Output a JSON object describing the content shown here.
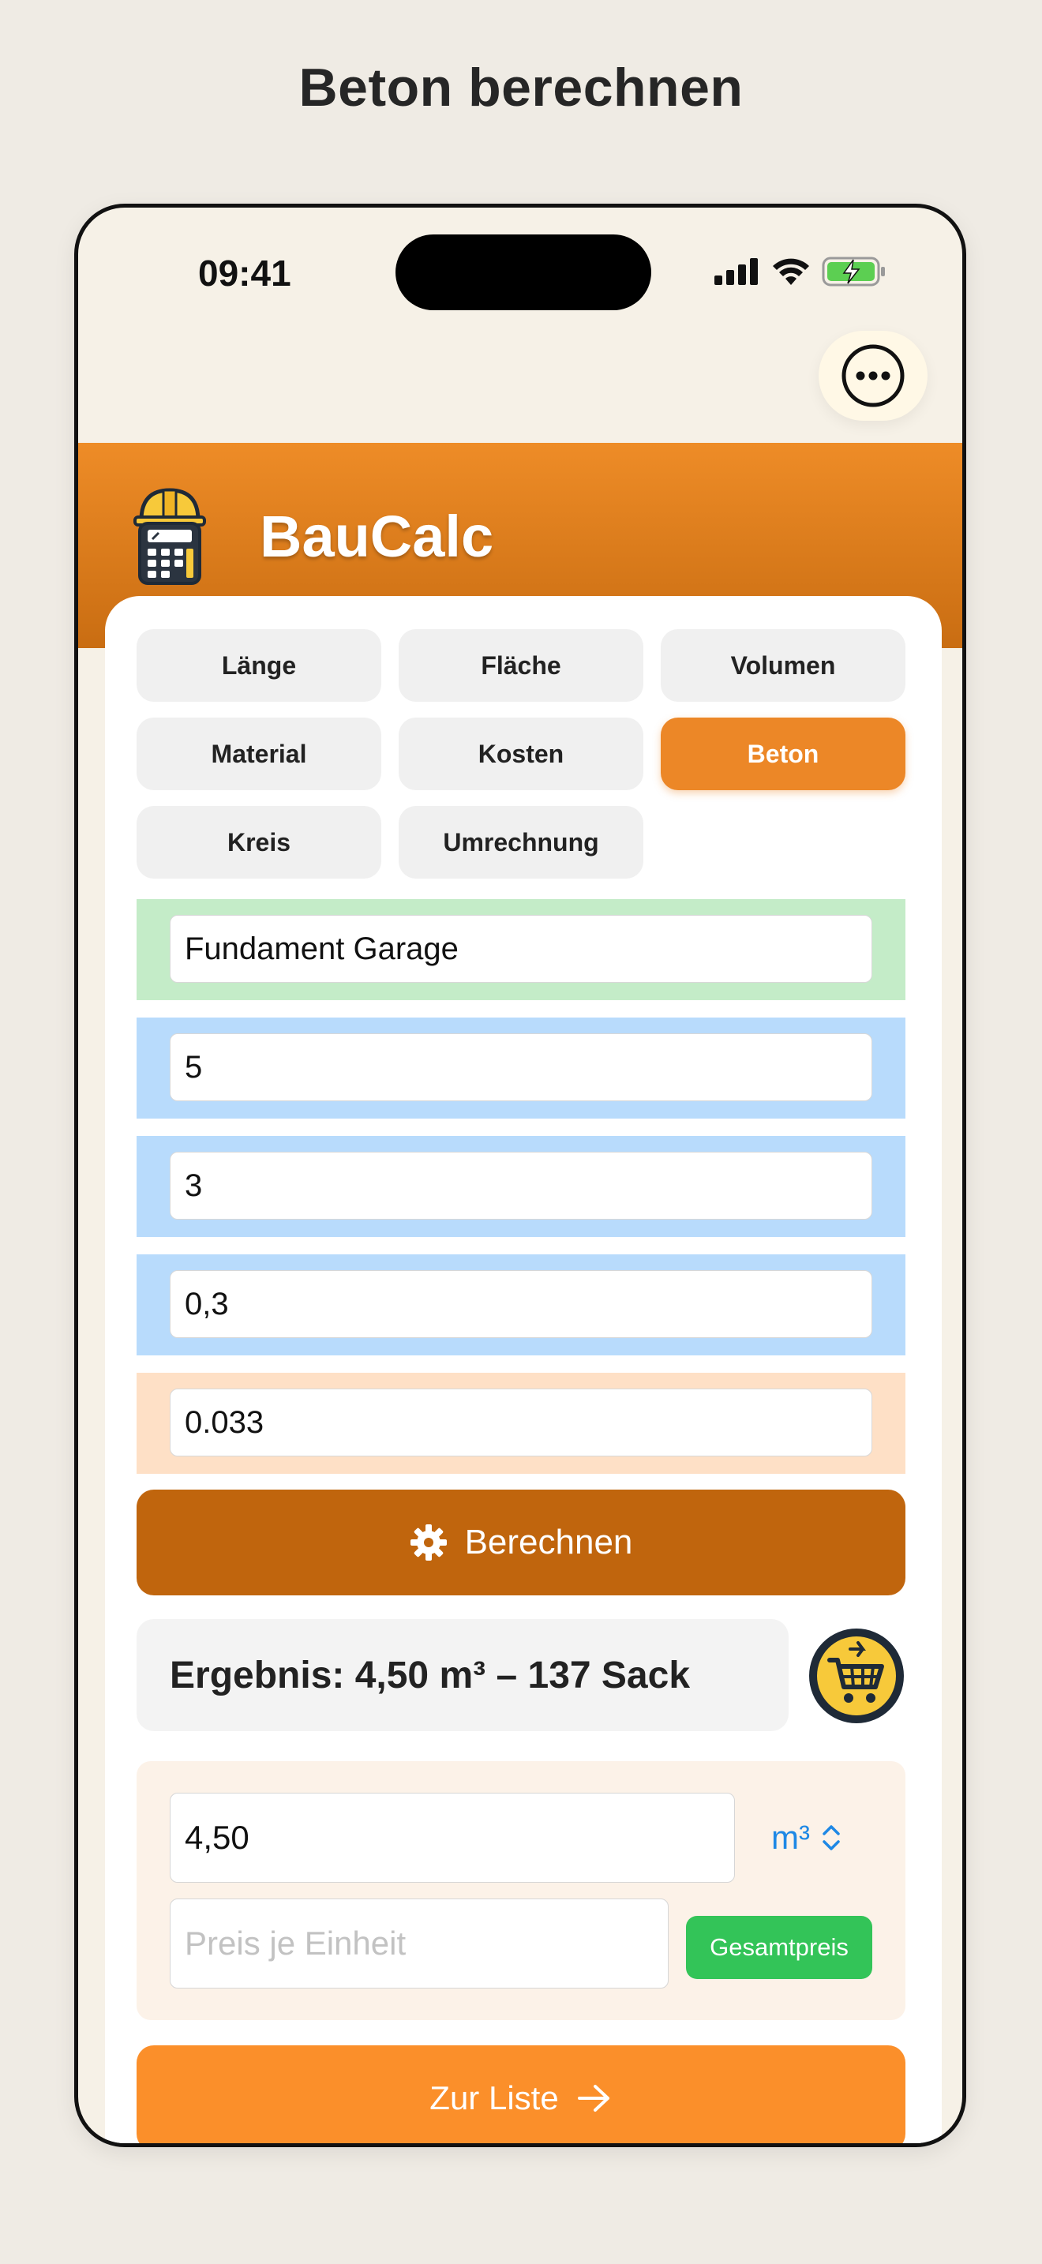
{
  "page": {
    "title": "Beton berechnen"
  },
  "status_bar": {
    "time": "09:41"
  },
  "app": {
    "name": "BauCalc",
    "logo_icon": "calculator-helmet-icon"
  },
  "tabs": [
    {
      "label": "Länge",
      "active": false
    },
    {
      "label": "Fläche",
      "active": false
    },
    {
      "label": "Volumen",
      "active": false
    },
    {
      "label": "Material",
      "active": false
    },
    {
      "label": "Kosten",
      "active": false
    },
    {
      "label": "Beton",
      "active": true
    },
    {
      "label": "Kreis",
      "active": false
    },
    {
      "label": "Umrechnung",
      "active": false
    }
  ],
  "fields": {
    "name": "Fundament Garage",
    "length": "5",
    "width": "3",
    "depth": "0,3",
    "bag_volume": "0.033"
  },
  "calculate_button": {
    "label": "Berechnen",
    "icon": "gear-icon"
  },
  "result": {
    "text": "Ergebnis: 4,50 m³ – 137 Sack"
  },
  "cart_button": {
    "icon": "shopping-cart-icon"
  },
  "price": {
    "quantity": "4,50",
    "unit": "m³",
    "price_placeholder": "Preis je Einheit",
    "total_label": "Gesamtpreis"
  },
  "list_button": {
    "label": "Zur Liste",
    "icon": "arrow-right-icon"
  },
  "colors": {
    "accent": "#ec8727",
    "header_top": "#ee8c27",
    "calculate": "#c0650d",
    "list_button": "#fb8f2a",
    "total_button": "#33c458",
    "link_blue": "#1e88e5"
  }
}
